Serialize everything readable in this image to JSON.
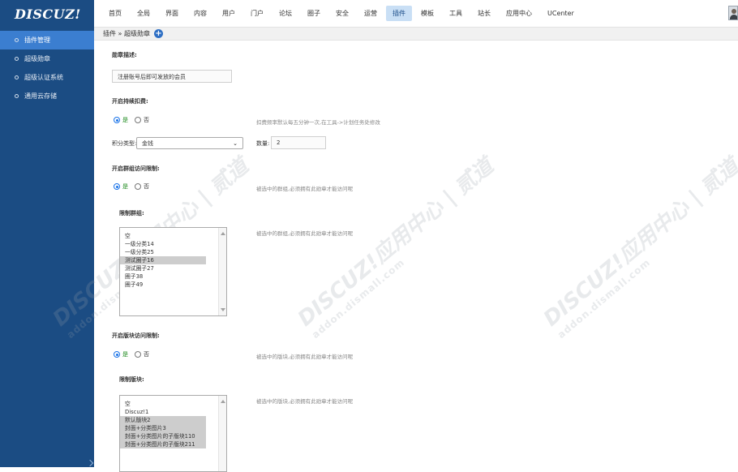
{
  "logo": "DISCUZ!",
  "sidebar": {
    "items": [
      {
        "label": "插件管理"
      },
      {
        "label": "超级勋章"
      },
      {
        "label": "超级认证系统"
      },
      {
        "label": "通用云存储"
      }
    ]
  },
  "topnav": {
    "items": [
      {
        "label": "首页"
      },
      {
        "label": "全局"
      },
      {
        "label": "界面"
      },
      {
        "label": "内容"
      },
      {
        "label": "用户"
      },
      {
        "label": "门户"
      },
      {
        "label": "论坛"
      },
      {
        "label": "圈子"
      },
      {
        "label": "安全"
      },
      {
        "label": "运营"
      },
      {
        "label": "插件"
      },
      {
        "label": "模板"
      },
      {
        "label": "工具"
      },
      {
        "label": "站长"
      },
      {
        "label": "应用中心"
      },
      {
        "label": "UCenter"
      }
    ],
    "active_index": 10
  },
  "breadcrumb": "插件 » 超级勋章",
  "form": {
    "desc_title": "勋章描述:",
    "desc_value": "注册账号后即可发放的会员",
    "deduct_title": "开启持续扣费:",
    "yes_label": "是",
    "no_label": "否",
    "deduct_hint": "扣费频率默认每五分钟一次,在工具->计划任务处修改",
    "credit_label": "积分类型:",
    "credit_value": "金钱",
    "amount_label": "数量:",
    "amount_value": "2",
    "group_title": "开启群组访问限制:",
    "group_hint": "被选中的群组,必须拥有此勋章才能访问呢",
    "group_limit_label": "限制群组:",
    "group_list_hint": "被选中的群组,必须拥有此勋章才能访问呢",
    "group_options": [
      {
        "label": "空",
        "selected": false
      },
      {
        "label": "一级分类14",
        "selected": false
      },
      {
        "label": "一级分类25",
        "selected": false
      },
      {
        "label": "测试圈子16",
        "selected": true
      },
      {
        "label": "测试圈子27",
        "selected": false
      },
      {
        "label": "圈子38",
        "selected": false
      },
      {
        "label": "圈子49",
        "selected": false
      }
    ],
    "forum_title": "开启版块访问限制:",
    "forum_hint": "被选中的版块,必须拥有此勋章才能访问呢",
    "forum_limit_label": "限制版块:",
    "forum_list_hint": "被选中的版块,必须拥有此勋章才能访问呢",
    "forum_options": [
      {
        "label": "空",
        "selected": false
      },
      {
        "label": "Discuz!1",
        "selected": false
      },
      {
        "label": "默认版块2",
        "selected": true
      },
      {
        "label": "封面+分类图片3",
        "selected": true
      },
      {
        "label": "封面+分类图片的子版块110",
        "selected": true
      },
      {
        "label": "封面+分类图片的子版块211",
        "selected": true
      }
    ]
  },
  "watermark": {
    "big": "DISCUZ!应用中心 | 贰道",
    "small": "addon.dismall.com"
  }
}
